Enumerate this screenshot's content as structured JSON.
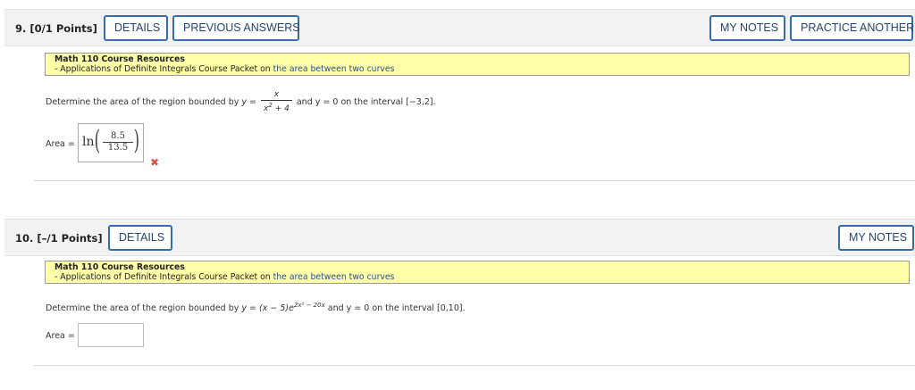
{
  "q9": {
    "number": "9.",
    "points": "[0/1 Points]",
    "buttons": {
      "details": "DETAILS",
      "previous_answers": "PREVIOUS ANSWERS",
      "my_notes": "MY NOTES",
      "practice_another": "PRACTICE ANOTHER"
    },
    "resources": {
      "title": "Math 110 Course Resources",
      "text": "- Applications of Definite Integrals Course Packet on ",
      "link": "the area between two curves"
    },
    "prompt": {
      "before": "Determine the area of the region bounded by ",
      "y_eq": "y = ",
      "frac_num": "x",
      "frac_den_base": "x",
      "frac_den_exp": "2",
      "frac_den_rest": " + 4",
      "after": " and y = 0 on the interval [−3,2]."
    },
    "area_label": "Area =",
    "answer": {
      "ln": "ln",
      "numerator": "8.5",
      "denominator": "13.5"
    },
    "status_icon": "cross-icon",
    "status_color": "#d9534f"
  },
  "q10": {
    "number": "10.",
    "points": "[–/1 Points]",
    "buttons": {
      "details": "DETAILS",
      "my_notes": "MY NOTES"
    },
    "resources": {
      "title": "Math 110 Course Resources",
      "text": "- Applications of Definite Integrals Course Packet on ",
      "link": "the area between two curves"
    },
    "prompt": {
      "before": "Determine the area of the region bounded by ",
      "expr": "y = (x − 5)e",
      "exp": "2x² − 20x",
      "after": " and y = 0 on the interval [0,10]."
    },
    "area_label": "Area =",
    "answer_value": ""
  },
  "colors": {
    "button_border": "#3a6da8",
    "button_text": "#24466f",
    "resources_bg": "#ffffaa",
    "link": "#2a4f8c"
  }
}
